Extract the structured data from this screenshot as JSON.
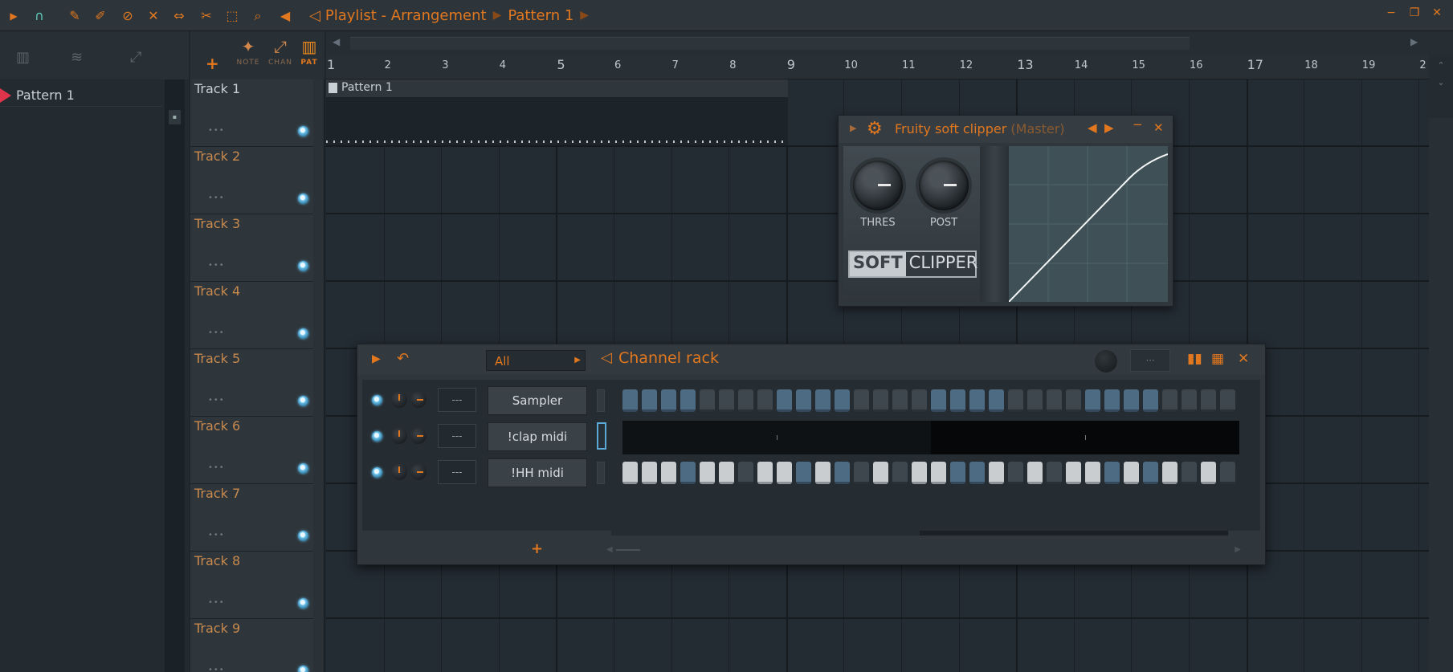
{
  "window": {
    "title": "Playlist - Arrangement",
    "breadcrumb": "Pattern 1"
  },
  "picker": {
    "patterns": [
      {
        "label": "Pattern 1"
      }
    ]
  },
  "playlist_tools": {
    "modes": [
      {
        "label": "NOTE"
      },
      {
        "label": "CHAN"
      },
      {
        "label": "PAT"
      }
    ]
  },
  "ruler": {
    "bars": [
      "1",
      "2",
      "3",
      "4",
      "5",
      "6",
      "7",
      "8",
      "9",
      "10",
      "11",
      "12",
      "13",
      "14",
      "15",
      "16",
      "17",
      "18",
      "19",
      "2"
    ]
  },
  "tracks": [
    {
      "label": "Track 1"
    },
    {
      "label": "Track 2"
    },
    {
      "label": "Track 3"
    },
    {
      "label": "Track 4"
    },
    {
      "label": "Track 5"
    },
    {
      "label": "Track 6"
    },
    {
      "label": "Track 7"
    },
    {
      "label": "Track 8"
    },
    {
      "label": "Track 9"
    }
  ],
  "clip": {
    "label": "Pattern 1"
  },
  "plugin": {
    "name": "Fruity soft clipper",
    "target": "(Master)",
    "knobs": [
      {
        "label": "THRES"
      },
      {
        "label": "POST"
      }
    ],
    "logo_soft": "SOFT",
    "logo_clipper": "CLIPPER"
  },
  "rack": {
    "title": "Channel rack",
    "filter": "All",
    "channels": [
      {
        "name": "Sampler",
        "target": "---",
        "type": "steps",
        "steps": [
          1,
          1,
          1,
          1,
          0,
          0,
          0,
          0,
          1,
          1,
          1,
          1,
          0,
          0,
          0,
          0,
          1,
          1,
          1,
          1,
          0,
          0,
          0,
          0,
          1,
          1,
          1,
          1,
          0,
          0,
          0,
          0
        ]
      },
      {
        "name": "!clap midi",
        "target": "---",
        "type": "piano"
      },
      {
        "name": "!HH midi",
        "target": "---",
        "type": "steps",
        "steps": [
          2,
          2,
          2,
          1,
          2,
          2,
          0,
          2,
          2,
          1,
          2,
          1,
          0,
          2,
          0,
          2,
          2,
          1,
          1,
          2,
          0,
          2,
          0,
          2,
          2,
          1,
          2,
          1,
          2,
          0,
          2,
          0
        ]
      }
    ]
  },
  "colors": {
    "accent": "#e1771e",
    "background": "#1e272e",
    "led": "#6cc4ee"
  }
}
